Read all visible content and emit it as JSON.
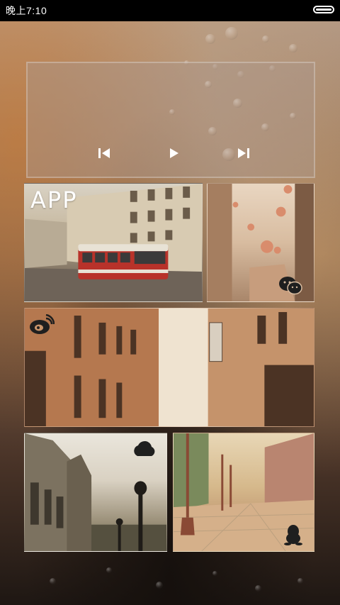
{
  "status_bar": {
    "time": "晚上7:10"
  },
  "music_widget": {
    "controls": [
      "previous",
      "play",
      "next"
    ]
  },
  "tiles": {
    "app": {
      "label": "APP"
    },
    "wechat": {
      "icon": "wechat-icon"
    },
    "weibo": {
      "icon": "weibo-icon"
    },
    "cloud": {
      "icon": "cloud-icon"
    },
    "qq": {
      "icon": "qq-penguin-icon"
    }
  }
}
